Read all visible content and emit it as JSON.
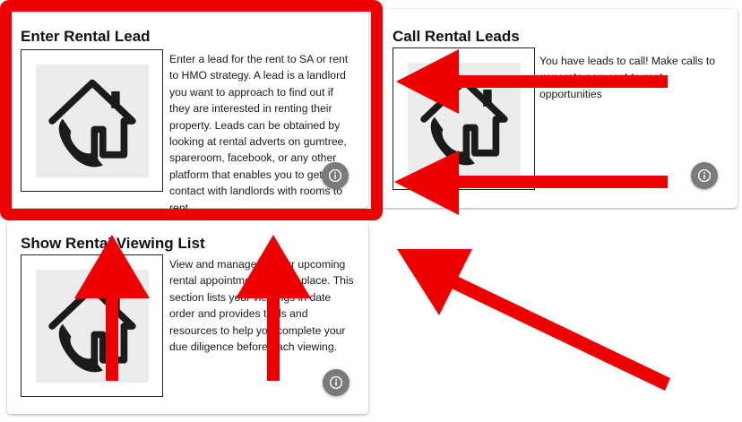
{
  "cards": [
    {
      "title": "Enter Rental Lead",
      "description": "Enter a lead for the rent to SA or rent to HMO strategy. A lead is a landlord you want to approach to find out if they are interested in renting their property. Leads can be obtained by looking at rental adverts on gumtree, spareroom, facebook, or any other platform that enables you to get in contact with landlords with rooms to rent.",
      "icon": "house-phone-icon",
      "action_icon": "info-icon"
    },
    {
      "title": "Call Rental Leads",
      "description": "You have leads to call! Make calls to generate new rent-to-rent opportunities",
      "icon": "house-phone-icon",
      "action_icon": "info-icon"
    },
    {
      "title": "Show Rental Viewing List",
      "description": "View and manage all your upcoming rental appointments in one place. This section lists your viewings in date order and provides tools and resources to help you complete your due diligence before each viewing.",
      "icon": "house-phone-icon",
      "action_icon": "info-icon"
    }
  ],
  "annotations": {
    "highlight_color": "#ee0000",
    "arrow_color": "#ee0000"
  }
}
